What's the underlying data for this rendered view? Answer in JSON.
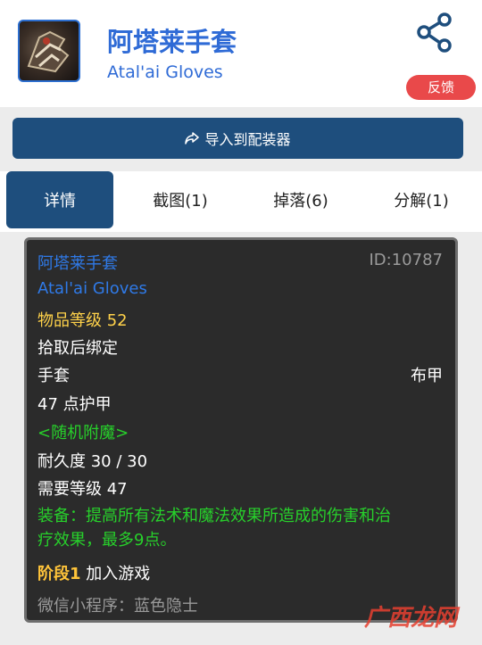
{
  "header": {
    "title": "阿塔莱手套",
    "subtitle": "Atal'ai Gloves",
    "feedback_label": "反馈",
    "icons": {
      "item": "glove-item-icon",
      "share": "share-icon"
    }
  },
  "import_button": {
    "label": "导入到配装器",
    "icon": "share-arrow-icon"
  },
  "tabs": [
    {
      "label": "详情",
      "active": true
    },
    {
      "label": "截图(1)",
      "active": false
    },
    {
      "label": "掉落(6)",
      "active": false
    },
    {
      "label": "分解(1)",
      "active": false
    }
  ],
  "tooltip": {
    "name_cn": "阿塔莱手套",
    "id": "ID:10787",
    "name_en": "Atal'ai Gloves",
    "item_level": "物品等级 52",
    "bind": "拾取后绑定",
    "slot": "手套",
    "armor_type": "布甲",
    "armor": "47 点护甲",
    "random_enchant": "<随机附魔>",
    "durability": "耐久度 30 / 30",
    "required_level": "需要等级 47",
    "equip_line1": "装备：提高所有法术和魔法效果所造成的伤害和治",
    "equip_line2": "疗效果，最多9点。",
    "stage_label": "阶段1",
    "stage_value": "加入游戏",
    "wechat": "微信小程序：蓝色隐士"
  },
  "watermark": {
    "text": "广西龙网",
    "small": ""
  },
  "colors": {
    "accent_blue": "#2f6bd6",
    "nav_dark_blue": "#1e4e7d",
    "feedback_red": "#e9494a",
    "tooltip_bg": "#2b2b2b",
    "green_text": "#27d12b",
    "gold_text": "#ffd24a"
  }
}
